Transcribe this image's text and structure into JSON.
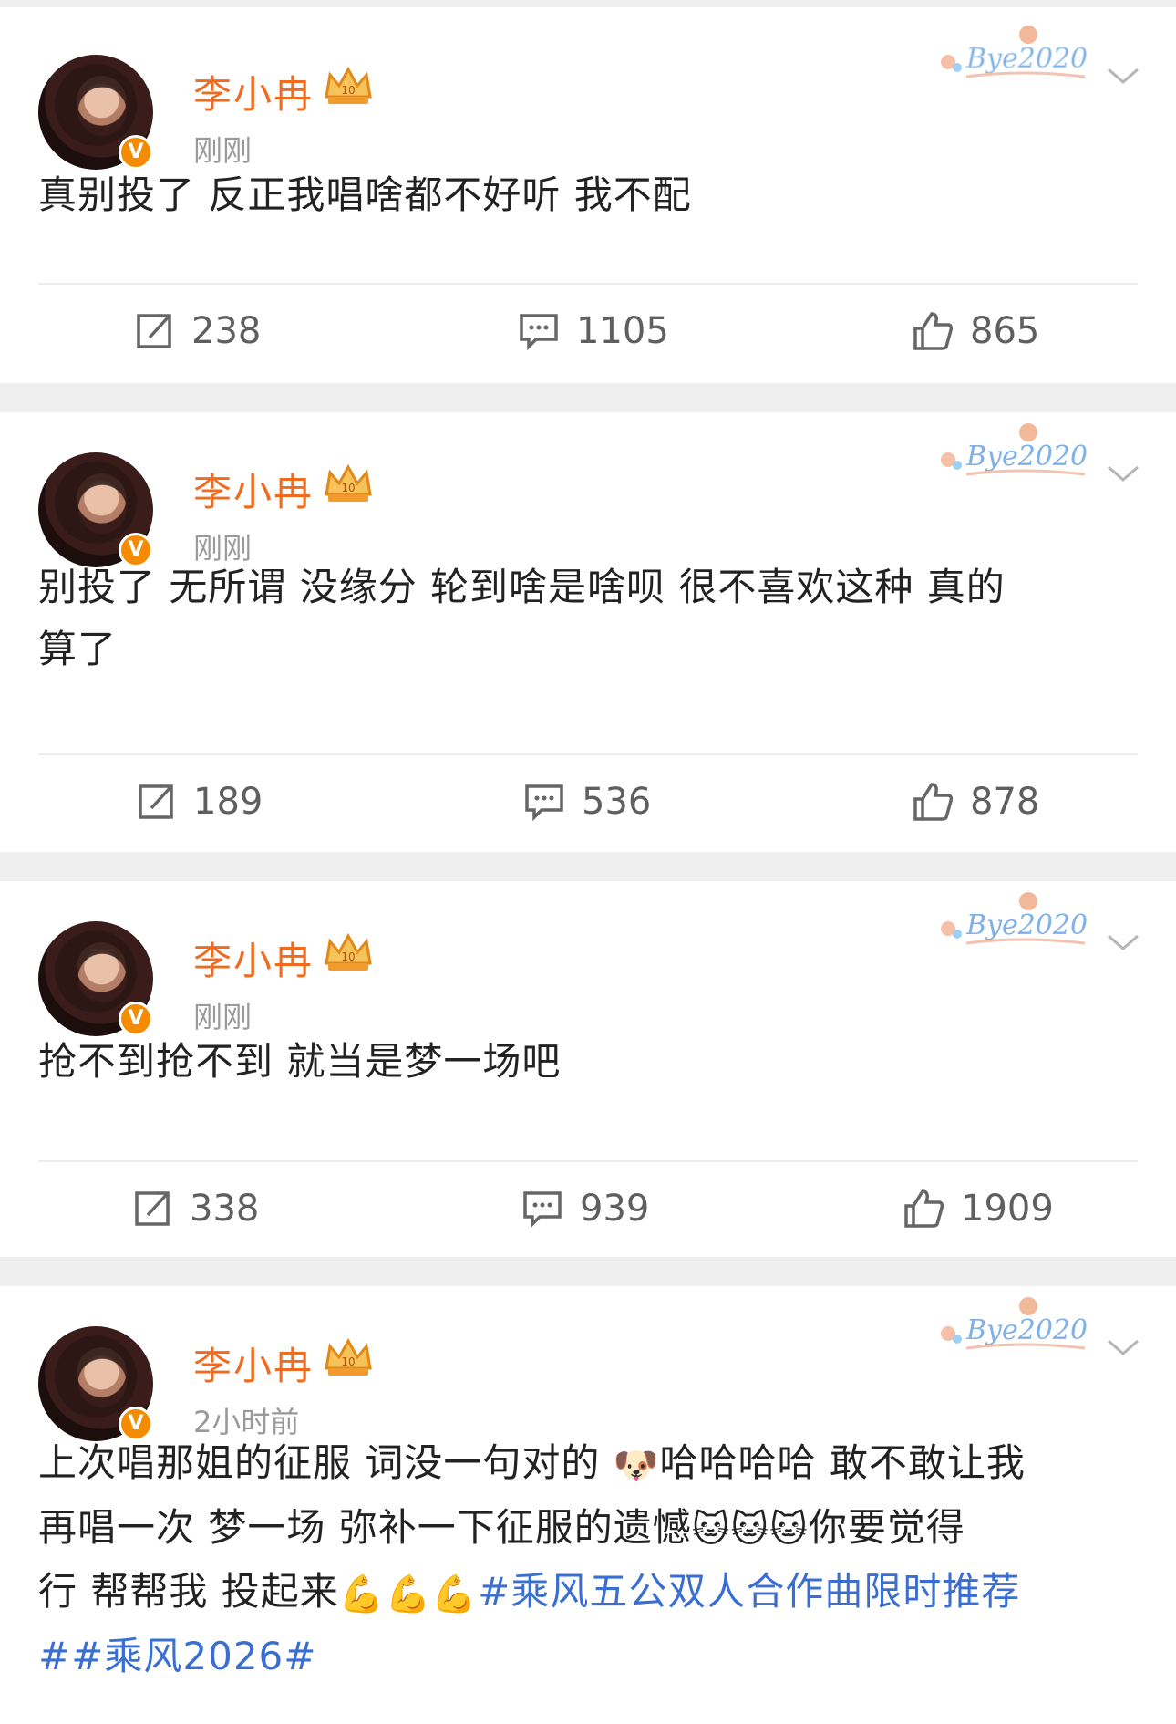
{
  "posts": [
    {
      "author": "李小冉",
      "time": "刚刚",
      "sticker": "Bye2020",
      "text": "真别投了 反正我唱啥都不好听 我不配",
      "repost_count": "238",
      "comment_count": "1105",
      "like_count": "865"
    },
    {
      "author": "李小冉",
      "time": "刚刚",
      "sticker": "Bye2020",
      "text_line1": "别投了 无所谓 没缘分 轮到啥是啥呗 很不喜欢这种 真的",
      "text_line2": "算了",
      "repost_count": "189",
      "comment_count": "536",
      "like_count": "878"
    },
    {
      "author": "李小冉",
      "time": "刚刚",
      "sticker": "Bye2020",
      "text": "抢不到抢不到 就当是梦一场吧",
      "repost_count": "338",
      "comment_count": "939",
      "like_count": "1909"
    },
    {
      "author": "李小冉",
      "time": "2小时前",
      "sticker": "Bye2020",
      "line1_a": "上次唱那姐的征服 词没一句对的 ",
      "line1_b": "哈哈哈哈 敢不敢让我",
      "line2_a": "再唱一次 梦一场 弥补一下征服的遗憾",
      "line2_b": "你要觉得",
      "line3_a": "行 帮帮我 投起来",
      "line3_tag": "#乘风五公双人合作曲限时推荐",
      "line4_tag": "##乘风2026#"
    }
  ],
  "icons": {
    "repost": "repost-icon",
    "comment": "comment-icon",
    "like": "thumbs-up-icon",
    "more": "chevron-down-icon",
    "verified": "verified-v-badge"
  },
  "colors": {
    "name": "#f16b1e",
    "hashtag": "#3a6fd1",
    "badge": "#f58b00"
  }
}
